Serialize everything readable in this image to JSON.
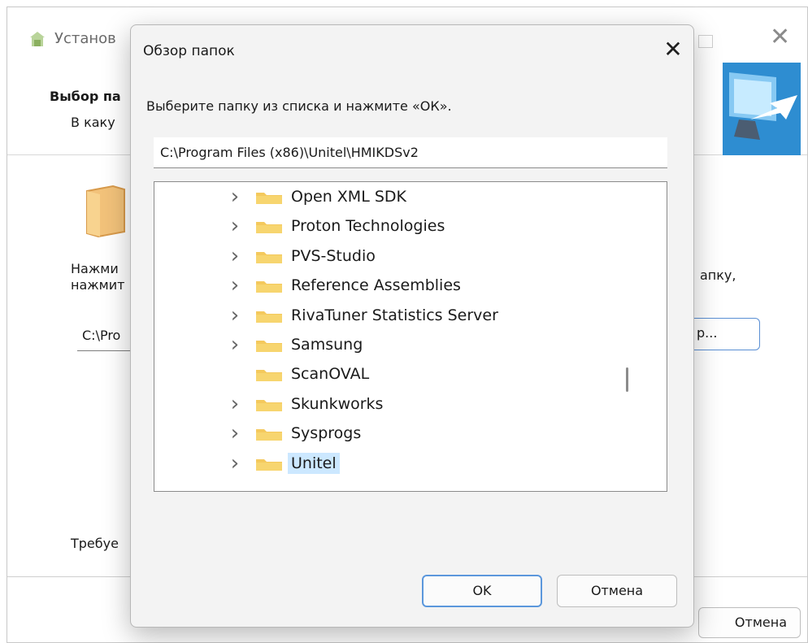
{
  "background": {
    "title": "Установ",
    "heading": "Выбор па",
    "subheading": "В каку",
    "instruction_left": "Нажми",
    "instruction_left_2": "нажмит",
    "instruction_right": "апку,",
    "path": "C:\\Pro",
    "browse_label": "р...",
    "required": "Требуе",
    "cancel_label": "Отмена"
  },
  "dialog": {
    "title": "Обзор папок",
    "close_label": "✕",
    "instruction": "Выберите папку из списка и нажмите «ОК».",
    "path": "C:\\Program Files (x86)\\Unitel\\HMIKDSv2",
    "tree": [
      {
        "label": "Open XML SDK",
        "has_children": true,
        "selected": false
      },
      {
        "label": "Proton Technologies",
        "has_children": true,
        "selected": false
      },
      {
        "label": "PVS-Studio",
        "has_children": true,
        "selected": false
      },
      {
        "label": "Reference Assemblies",
        "has_children": true,
        "selected": false
      },
      {
        "label": "RivaTuner Statistics Server",
        "has_children": true,
        "selected": false
      },
      {
        "label": "Samsung",
        "has_children": true,
        "selected": false
      },
      {
        "label": "ScanOVAL",
        "has_children": false,
        "selected": false
      },
      {
        "label": "Skunkworks",
        "has_children": true,
        "selected": false
      },
      {
        "label": "Sysprogs",
        "has_children": true,
        "selected": false
      },
      {
        "label": "Unitel",
        "has_children": true,
        "selected": true
      }
    ],
    "ok_label": "OK",
    "cancel_label": "Отмена"
  },
  "icons": {
    "folder": "folder-icon",
    "chevron": "chevron-right-icon",
    "close": "close-icon"
  },
  "colors": {
    "accent": "#5b97dc",
    "selection": "#cce8ff",
    "folder": "#f4c95d"
  }
}
